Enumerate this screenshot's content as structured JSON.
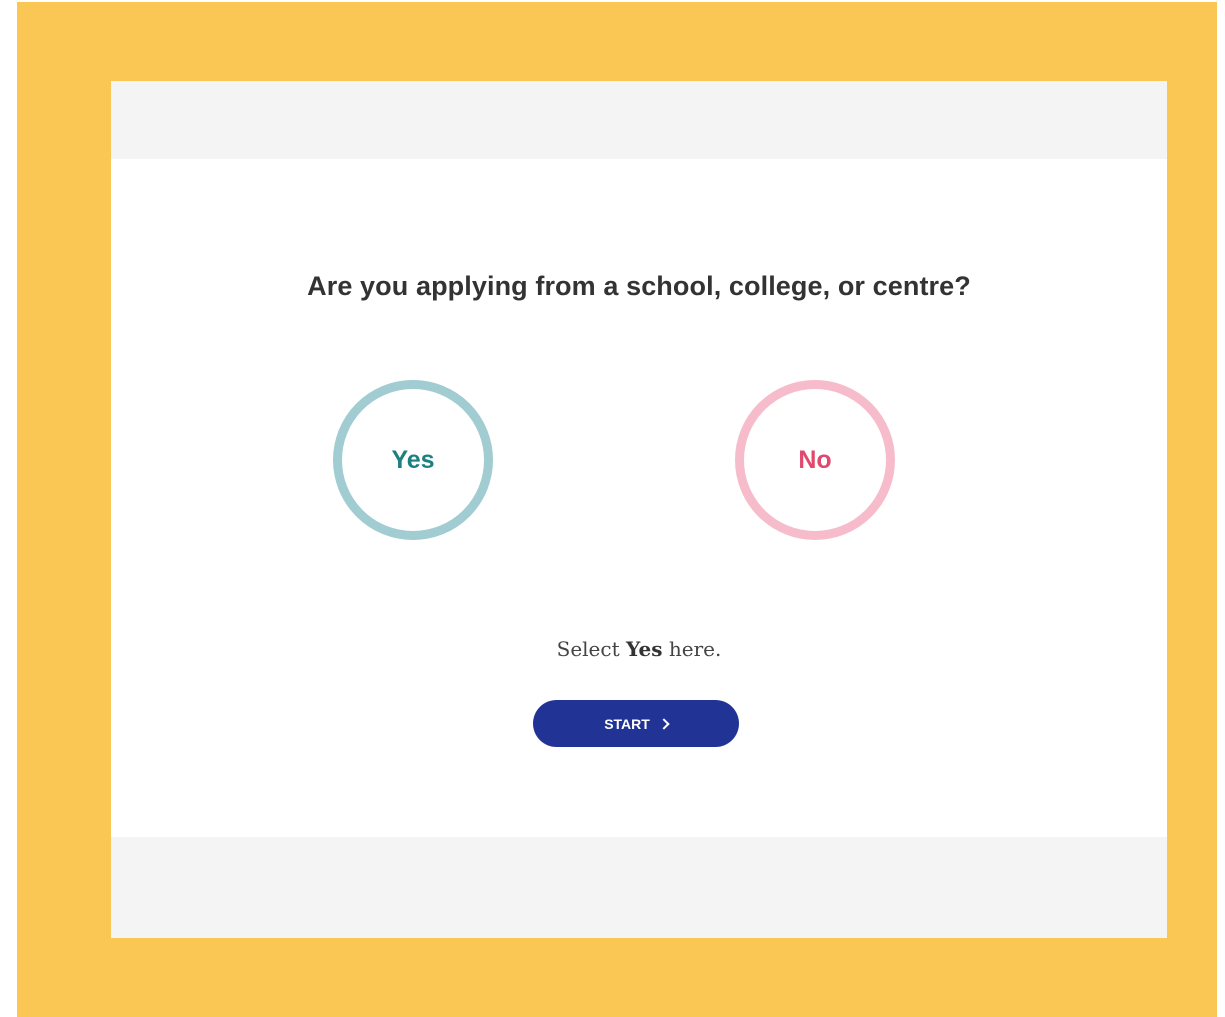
{
  "colors": {
    "frame": "#fac654",
    "band": "#f4f4f4",
    "yes_ring": "#a1ccd1",
    "yes_text": "#1c7f80",
    "no_ring": "#f7bccb",
    "no_text": "#e0486e",
    "button": "#213496"
  },
  "question": {
    "text": "Are you applying from a school, college, or centre?"
  },
  "choices": [
    {
      "label": "Yes"
    },
    {
      "label": "No"
    }
  ],
  "hint": {
    "prefix": "Select ",
    "emphasis": "Yes",
    "suffix": " here."
  },
  "start_button": {
    "label": "START",
    "icon": "chevron-right-icon"
  }
}
